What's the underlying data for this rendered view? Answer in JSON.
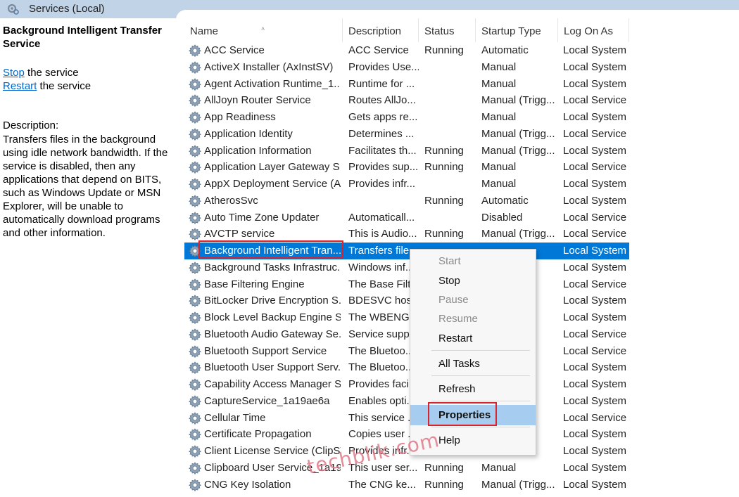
{
  "window": {
    "title": "Services (Local)"
  },
  "left_pane": {
    "service_title": "Background Intelligent Transfer Service",
    "stop_link": "Stop",
    "stop_suffix": " the service",
    "restart_link": "Restart",
    "restart_suffix": " the service",
    "description_label": "Description:",
    "description": "Transfers files in the background using idle network bandwidth. If the service is disabled, then any applications that depend on BITS, such as Windows Update or MSN Explorer, will be unable to automatically download programs and other information."
  },
  "columns": {
    "name": "Name",
    "description": "Description",
    "status": "Status",
    "startup": "Startup Type",
    "logon": "Log On As"
  },
  "rows": [
    {
      "name": "ACC Service",
      "desc": "ACC Service",
      "status": "Running",
      "startup": "Automatic",
      "logon": "Local System"
    },
    {
      "name": "ActiveX Installer (AxInstSV)",
      "desc": "Provides Use...",
      "status": "",
      "startup": "Manual",
      "logon": "Local System"
    },
    {
      "name": "Agent Activation Runtime_1...",
      "desc": "Runtime for ...",
      "status": "",
      "startup": "Manual",
      "logon": "Local System"
    },
    {
      "name": "AllJoyn Router Service",
      "desc": "Routes AllJo...",
      "status": "",
      "startup": "Manual (Trigg...",
      "logon": "Local Service"
    },
    {
      "name": "App Readiness",
      "desc": "Gets apps re...",
      "status": "",
      "startup": "Manual",
      "logon": "Local System"
    },
    {
      "name": "Application Identity",
      "desc": "Determines ...",
      "status": "",
      "startup": "Manual (Trigg...",
      "logon": "Local Service"
    },
    {
      "name": "Application Information",
      "desc": "Facilitates th...",
      "status": "Running",
      "startup": "Manual (Trigg...",
      "logon": "Local System"
    },
    {
      "name": "Application Layer Gateway S...",
      "desc": "Provides sup...",
      "status": "Running",
      "startup": "Manual",
      "logon": "Local Service"
    },
    {
      "name": "AppX Deployment Service (A...",
      "desc": "Provides infr...",
      "status": "",
      "startup": "Manual",
      "logon": "Local System"
    },
    {
      "name": "AtherosSvc",
      "desc": "",
      "status": "Running",
      "startup": "Automatic",
      "logon": "Local System"
    },
    {
      "name": "Auto Time Zone Updater",
      "desc": "Automaticall...",
      "status": "",
      "startup": "Disabled",
      "logon": "Local Service"
    },
    {
      "name": "AVCTP service",
      "desc": "This is Audio...",
      "status": "Running",
      "startup": "Manual (Trigg...",
      "logon": "Local Service"
    },
    {
      "name": "Background Intelligent Tran...",
      "desc": "Transfers file...",
      "status": "",
      "startup": "",
      "logon": "Local System"
    },
    {
      "name": "Background Tasks Infrastruc...",
      "desc": "Windows inf...",
      "status": "",
      "startup": "",
      "logon": "Local System"
    },
    {
      "name": "Base Filtering Engine",
      "desc": "The Base Filt...",
      "status": "",
      "startup": "",
      "logon": "Local Service"
    },
    {
      "name": "BitLocker Drive Encryption S...",
      "desc": "BDESVC hos...",
      "status": "",
      "startup": "",
      "logon": "Local System"
    },
    {
      "name": "Block Level Backup Engine S...",
      "desc": "The WBENGI...",
      "status": "",
      "startup": "",
      "logon": "Local System"
    },
    {
      "name": "Bluetooth Audio Gateway Se...",
      "desc": "Service supp...",
      "status": "",
      "startup": "",
      "logon": "Local Service"
    },
    {
      "name": "Bluetooth Support Service",
      "desc": "The Bluetoo...",
      "status": "",
      "startup": "",
      "logon": "Local Service"
    },
    {
      "name": "Bluetooth User Support Serv...",
      "desc": "The Bluetoo...",
      "status": "",
      "startup": "",
      "logon": "Local System"
    },
    {
      "name": "Capability Access Manager S...",
      "desc": "Provides faci...",
      "status": "",
      "startup": "",
      "logon": "Local System"
    },
    {
      "name": "CaptureService_1a19ae6a",
      "desc": "Enables opti...",
      "status": "",
      "startup": "",
      "logon": "Local System"
    },
    {
      "name": "Cellular Time",
      "desc": "This service ...",
      "status": "",
      "startup": "",
      "logon": "Local Service"
    },
    {
      "name": "Certificate Propagation",
      "desc": "Copies user ...",
      "status": "",
      "startup": "",
      "logon": "Local System"
    },
    {
      "name": "Client License Service (ClipSV...",
      "desc": "Provides infr...",
      "status": "",
      "startup": "",
      "logon": "Local System"
    },
    {
      "name": "Clipboard User Service_1a19...",
      "desc": "This user ser...",
      "status": "Running",
      "startup": "Manual",
      "logon": "Local System"
    },
    {
      "name": "CNG Key Isolation",
      "desc": "The CNG ke...",
      "status": "Running",
      "startup": "Manual (Trigg...",
      "logon": "Local System"
    }
  ],
  "context_menu": {
    "start": "Start",
    "stop": "Stop",
    "pause": "Pause",
    "resume": "Resume",
    "restart": "Restart",
    "all_tasks": "All Tasks",
    "refresh": "Refresh",
    "properties": "Properties",
    "help": "Help"
  },
  "watermark": "techblik.com",
  "colors": {
    "selection": "#0078d7",
    "highlight": "#a6cdf0",
    "annotation": "#d9232d",
    "link": "#0066cc"
  }
}
